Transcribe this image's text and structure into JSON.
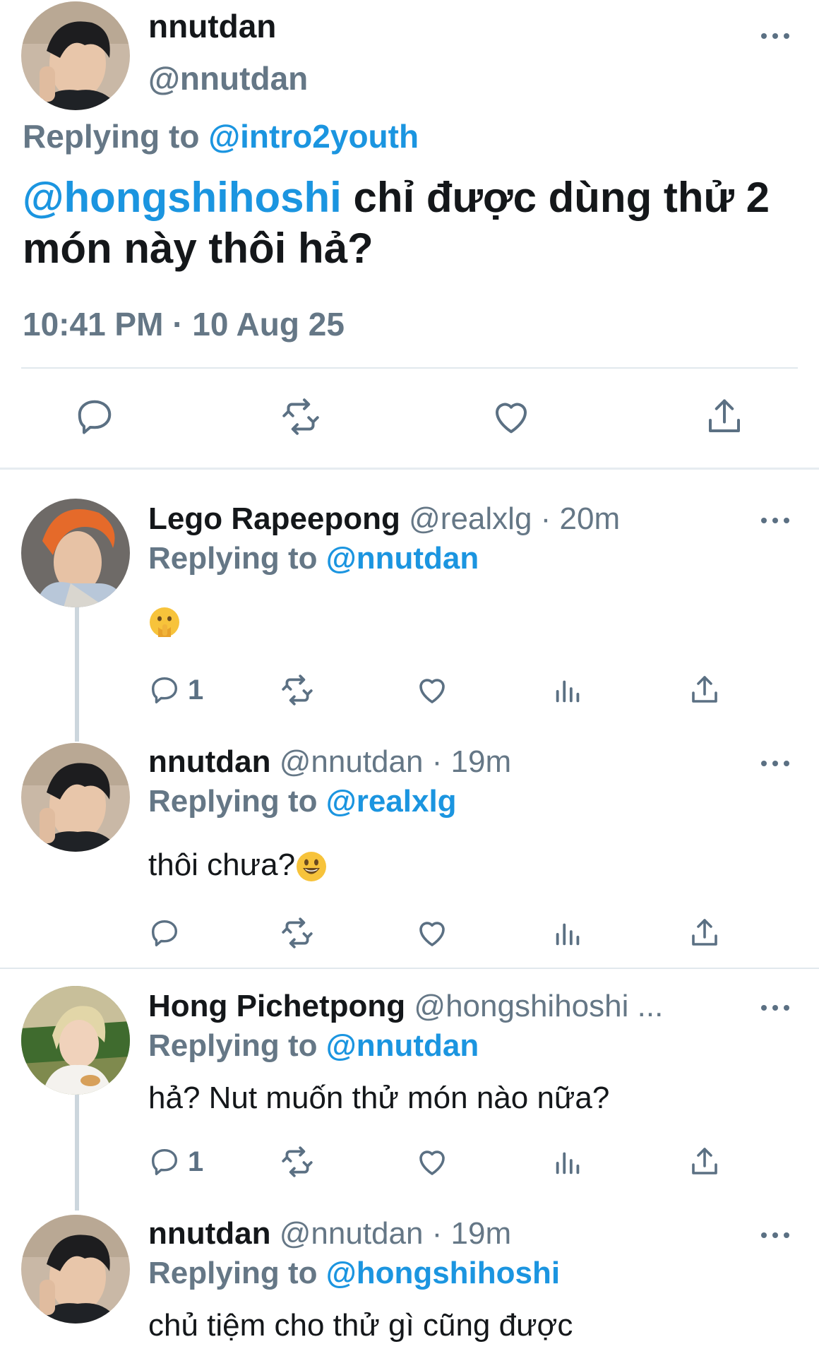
{
  "main_tweet": {
    "name": "nnutdan",
    "handle": "@nnutdan",
    "replying_prefix": "Replying to",
    "replying_to": "@intro2youth",
    "mention": "@hongshihoshi",
    "text": " chỉ được dùng thử 2 món này thôi hả?",
    "timestamp": "10:41 PM · 10 Aug 25",
    "actions": [
      "reply-icon",
      "retweet-icon",
      "like-icon",
      "share-icon"
    ]
  },
  "replies": [
    {
      "name": "Lego Rapeepong",
      "meta": " @realxlg · 20m",
      "replying_prefix": "Replying to",
      "replying_to": "@nnutdan",
      "text": "",
      "emoji": "shushing-face-emoji",
      "reply_count": "1"
    },
    {
      "name": "nnutdan",
      "meta": " @nnutdan · 19m",
      "replying_prefix": "Replying to",
      "replying_to": "@realxlg",
      "text": "thôi chưa?",
      "emoji": "smiling-face-emoji",
      "reply_count": ""
    },
    {
      "name": "Hong Pichetpong",
      "meta": " @hongshihoshi ...",
      "replying_prefix": "Replying to",
      "replying_to": "@nnutdan",
      "text": "hả? Nut muốn thử món nào nữa?",
      "reply_count": "1"
    },
    {
      "name": "nnutdan",
      "meta": " @nnutdan · 19m",
      "replying_prefix": "Replying to",
      "replying_to": "@hongshihoshi",
      "text": "chủ tiệm cho thử gì cũng được"
    }
  ],
  "colors": {
    "link_blue": "#1b95e0",
    "secondary_gray": "#657786",
    "text_black": "#14171a",
    "icon_gray": "#5b7083"
  }
}
